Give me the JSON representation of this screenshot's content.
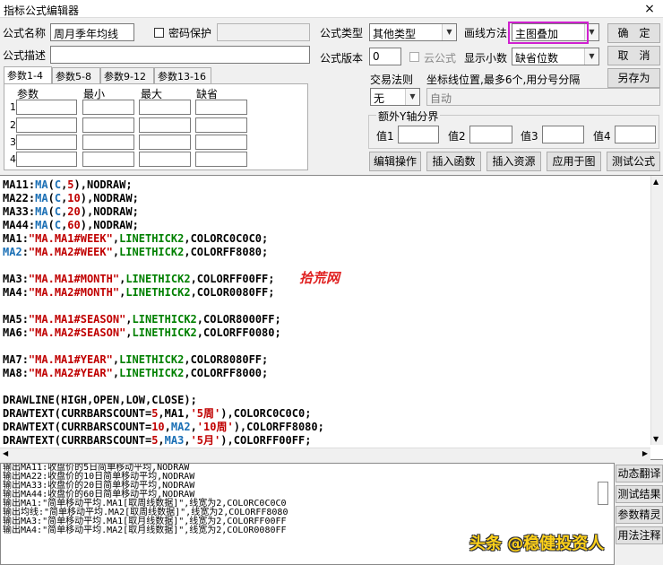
{
  "window": {
    "title": "指标公式编辑器",
    "close": "×"
  },
  "form": {
    "name_label": "公式名称",
    "name_value": "周月季年均线",
    "password_label": "密码保护",
    "desc_label": "公式描述",
    "type_label": "公式类型",
    "type_value": "其他类型",
    "draw_label": "画线方法",
    "draw_value": "主图叠加",
    "version_label": "公式版本",
    "version_value": "0",
    "cloud_label": "云公式",
    "decimal_label": "显示小数",
    "decimal_value": "缺省位数",
    "trade_label": "交易法则",
    "trade_value": "无",
    "coord_label": "坐标线位置,最多6个,用分号分隔",
    "coord_value": "自动",
    "yaxis_label": "额外Y轴分界",
    "yaxis_values": [
      "值1",
      "值2",
      "值3",
      "值4"
    ]
  },
  "buttons": {
    "ok": "确　定",
    "cancel": "取　消",
    "saveas": "另存为",
    "edit_op": "编辑操作",
    "insert_func": "插入函数",
    "insert_res": "插入资源",
    "apply": "应用于图",
    "test": "测试公式"
  },
  "tabs": [
    "参数1-4",
    "参数5-8",
    "参数9-12",
    "参数13-16"
  ],
  "param_headers": [
    "参数",
    "最小",
    "最大",
    "缺省"
  ],
  "param_rows": [
    "1",
    "2",
    "3",
    "4"
  ],
  "code_lines": [
    "MA11:MA(C,5),NODRAW;",
    "MA22:MA(C,10),NODRAW;",
    "MA33:MA(C,20),NODRAW;",
    "MA44:MA(C,60),NODRAW;",
    "MA1:\"MA.MA1#WEEK\",LINETHICK2,COLORC0C0C0;",
    "MA2:\"MA.MA2#WEEK\",LINETHICK2,COLORFF8080;",
    "",
    "MA3:\"MA.MA1#MONTH\",LINETHICK2,COLORFF00FF;",
    "MA4:\"MA.MA2#MONTH\",LINETHICK2,COLOR0080FF;",
    "",
    "MA5:\"MA.MA1#SEASON\",LINETHICK2,COLOR8000FF;",
    "MA6:\"MA.MA2#SEASON\",LINETHICK2,COLORFF0080;",
    "",
    "MA7:\"MA.MA1#YEAR\",LINETHICK2,COLOR8080FF;",
    "MA8:\"MA.MA2#YEAR\",LINETHICK2,COLORFF8000;",
    "",
    "DRAWLINE(HIGH,OPEN,LOW,CLOSE);",
    "DRAWTEXT(CURRBARSCOUNT=5,MA1,'5周'),COLORC0C0C0;",
    "DRAWTEXT(CURRBARSCOUNT=10,MA2,'10周'),COLORFF8080;",
    "DRAWTEXT(CURRBARSCOUNT=5,MA3,'5月'),COLORFF00FF;"
  ],
  "output_lines": [
    "输出MA11:收盘价的5日简单移动平均,NODRAW",
    "输出MA22:收盘价的10日简单移动平均,NODRAW",
    "输出MA33:收盘价的20日简单移动平均,NODRAW",
    "输出MA44:收盘价的60日简单移动平均,NODRAW",
    "输出MA1:\"简单移动平均.MA1[取周线数据]\",线宽为2,COLORC0C0C0",
    "输出均线:\"简单移动平均.MA2[取周线数据]\",线宽为2,COLORFF8080",
    "输出MA3:\"简单移动平均.MA1[取月线数据]\",线宽为2,COLORFF00FF",
    "输出MA4:\"简单移动平均.MA2[取月线数据]\",线宽为2,COLOR0080FF"
  ],
  "side_buttons": [
    "动态翻译",
    "测试结果",
    "参数精灵",
    "用法注释"
  ],
  "watermarks": {
    "red": "拾荒网",
    "yellow": "头条 @稳健投资人"
  },
  "colors": {
    "highlight": "#d020d0",
    "number": "#c00000",
    "builtin": "#1a6fb5",
    "func": "#008000"
  }
}
